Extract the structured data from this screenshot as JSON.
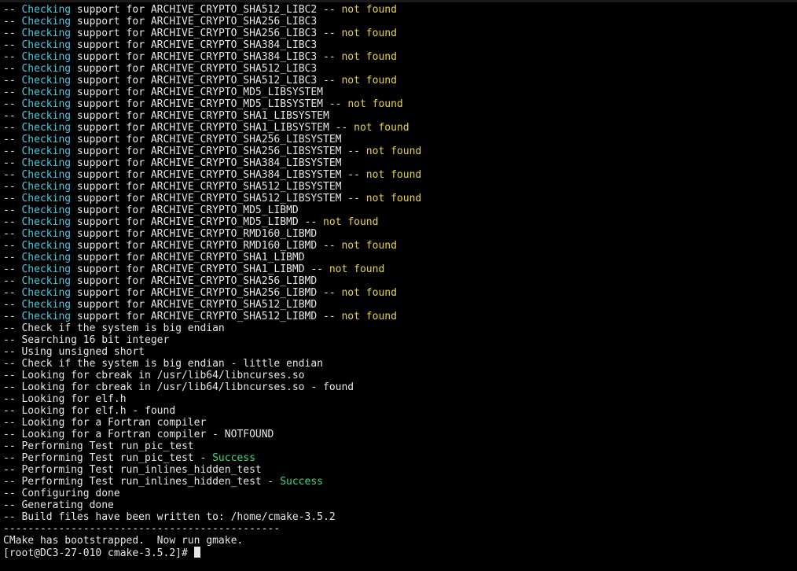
{
  "terminal": {
    "lines": [
      {
        "prefix": "-- ",
        "keyword": "Checking",
        "rest": " support for ARCHIVE_CRYPTO_SHA512_LIBC2 -- ",
        "status": "not found"
      },
      {
        "prefix": "-- ",
        "keyword": "Checking",
        "rest": " support for ARCHIVE_CRYPTO_SHA256_LIBC3",
        "status": ""
      },
      {
        "prefix": "-- ",
        "keyword": "Checking",
        "rest": " support for ARCHIVE_CRYPTO_SHA256_LIBC3 -- ",
        "status": "not found"
      },
      {
        "prefix": "-- ",
        "keyword": "Checking",
        "rest": " support for ARCHIVE_CRYPTO_SHA384_LIBC3",
        "status": ""
      },
      {
        "prefix": "-- ",
        "keyword": "Checking",
        "rest": " support for ARCHIVE_CRYPTO_SHA384_LIBC3 -- ",
        "status": "not found"
      },
      {
        "prefix": "-- ",
        "keyword": "Checking",
        "rest": " support for ARCHIVE_CRYPTO_SHA512_LIBC3",
        "status": ""
      },
      {
        "prefix": "-- ",
        "keyword": "Checking",
        "rest": " support for ARCHIVE_CRYPTO_SHA512_LIBC3 -- ",
        "status": "not found"
      },
      {
        "prefix": "-- ",
        "keyword": "Checking",
        "rest": " support for ARCHIVE_CRYPTO_MD5_LIBSYSTEM",
        "status": ""
      },
      {
        "prefix": "-- ",
        "keyword": "Checking",
        "rest": " support for ARCHIVE_CRYPTO_MD5_LIBSYSTEM -- ",
        "status": "not found"
      },
      {
        "prefix": "-- ",
        "keyword": "Checking",
        "rest": " support for ARCHIVE_CRYPTO_SHA1_LIBSYSTEM",
        "status": ""
      },
      {
        "prefix": "-- ",
        "keyword": "Checking",
        "rest": " support for ARCHIVE_CRYPTO_SHA1_LIBSYSTEM -- ",
        "status": "not found"
      },
      {
        "prefix": "-- ",
        "keyword": "Checking",
        "rest": " support for ARCHIVE_CRYPTO_SHA256_LIBSYSTEM",
        "status": ""
      },
      {
        "prefix": "-- ",
        "keyword": "Checking",
        "rest": " support for ARCHIVE_CRYPTO_SHA256_LIBSYSTEM -- ",
        "status": "not found"
      },
      {
        "prefix": "-- ",
        "keyword": "Checking",
        "rest": " support for ARCHIVE_CRYPTO_SHA384_LIBSYSTEM",
        "status": ""
      },
      {
        "prefix": "-- ",
        "keyword": "Checking",
        "rest": " support for ARCHIVE_CRYPTO_SHA384_LIBSYSTEM -- ",
        "status": "not found"
      },
      {
        "prefix": "-- ",
        "keyword": "Checking",
        "rest": " support for ARCHIVE_CRYPTO_SHA512_LIBSYSTEM",
        "status": ""
      },
      {
        "prefix": "-- ",
        "keyword": "Checking",
        "rest": " support for ARCHIVE_CRYPTO_SHA512_LIBSYSTEM -- ",
        "status": "not found"
      },
      {
        "prefix": "-- ",
        "keyword": "Checking",
        "rest": " support for ARCHIVE_CRYPTO_MD5_LIBMD",
        "status": ""
      },
      {
        "prefix": "-- ",
        "keyword": "Checking",
        "rest": " support for ARCHIVE_CRYPTO_MD5_LIBMD -- ",
        "status": "not found"
      },
      {
        "prefix": "-- ",
        "keyword": "Checking",
        "rest": " support for ARCHIVE_CRYPTO_RMD160_LIBMD",
        "status": ""
      },
      {
        "prefix": "-- ",
        "keyword": "Checking",
        "rest": " support for ARCHIVE_CRYPTO_RMD160_LIBMD -- ",
        "status": "not found"
      },
      {
        "prefix": "-- ",
        "keyword": "Checking",
        "rest": " support for ARCHIVE_CRYPTO_SHA1_LIBMD",
        "status": ""
      },
      {
        "prefix": "-- ",
        "keyword": "Checking",
        "rest": " support for ARCHIVE_CRYPTO_SHA1_LIBMD -- ",
        "status": "not found"
      },
      {
        "prefix": "-- ",
        "keyword": "Checking",
        "rest": " support for ARCHIVE_CRYPTO_SHA256_LIBMD",
        "status": ""
      },
      {
        "prefix": "-- ",
        "keyword": "Checking",
        "rest": " support for ARCHIVE_CRYPTO_SHA256_LIBMD -- ",
        "status": "not found"
      },
      {
        "prefix": "-- ",
        "keyword": "Checking",
        "rest": " support for ARCHIVE_CRYPTO_SHA512_LIBMD",
        "status": ""
      },
      {
        "prefix": "-- ",
        "keyword": "Checking",
        "rest": " support for ARCHIVE_CRYPTO_SHA512_LIBMD -- ",
        "status": "not found"
      },
      {
        "prefix": "-- Check if the system is big endian",
        "keyword": "",
        "rest": "",
        "status": ""
      },
      {
        "prefix": "-- Searching 16 bit integer",
        "keyword": "",
        "rest": "",
        "status": ""
      },
      {
        "prefix": "-- Using unsigned short",
        "keyword": "",
        "rest": "",
        "status": ""
      },
      {
        "prefix": "-- Check if the system is big endian - little endian",
        "keyword": "",
        "rest": "",
        "status": ""
      },
      {
        "prefix": "-- Looking for cbreak in /usr/lib64/libncurses.so",
        "keyword": "",
        "rest": "",
        "status": ""
      },
      {
        "prefix": "-- Looking for cbreak in /usr/lib64/libncurses.so - found",
        "keyword": "",
        "rest": "",
        "status": ""
      },
      {
        "prefix": "-- Looking for elf.h",
        "keyword": "",
        "rest": "",
        "status": ""
      },
      {
        "prefix": "-- Looking for elf.h - found",
        "keyword": "",
        "rest": "",
        "status": ""
      },
      {
        "prefix": "-- Looking for a Fortran compiler",
        "keyword": "",
        "rest": "",
        "status": ""
      },
      {
        "prefix": "-- Looking for a Fortran compiler - NOTFOUND",
        "keyword": "",
        "rest": "",
        "status": ""
      },
      {
        "prefix": "-- Performing Test run_pic_test",
        "keyword": "",
        "rest": "",
        "status": ""
      },
      {
        "prefix": "-- Performing Test run_pic_test - ",
        "keyword": "",
        "rest": "",
        "status": "",
        "success": "Success"
      },
      {
        "prefix": "-- Performing Test run_inlines_hidden_test",
        "keyword": "",
        "rest": "",
        "status": ""
      },
      {
        "prefix": "-- Performing Test run_inlines_hidden_test - ",
        "keyword": "",
        "rest": "",
        "status": "",
        "success": "Success"
      },
      {
        "prefix": "-- Configuring done",
        "keyword": "",
        "rest": "",
        "status": ""
      },
      {
        "prefix": "-- Generating done",
        "keyword": "",
        "rest": "",
        "status": ""
      },
      {
        "prefix": "-- Build files have been written to: /home/cmake-3.5.2",
        "keyword": "",
        "rest": "",
        "status": ""
      },
      {
        "prefix": "---------------------------------------------",
        "keyword": "",
        "rest": "",
        "status": ""
      },
      {
        "prefix": "CMake has bootstrapped.  Now run gmake.",
        "keyword": "",
        "rest": "",
        "status": ""
      }
    ],
    "prompt": "[root@DC3-27-010 cmake-3.5.2]# "
  },
  "colors": {
    "background": "#000000",
    "text": "#e6e6e6",
    "keyword": "#4fc8e0",
    "not_found": "#e8d44a",
    "success": "#3ddc84"
  }
}
